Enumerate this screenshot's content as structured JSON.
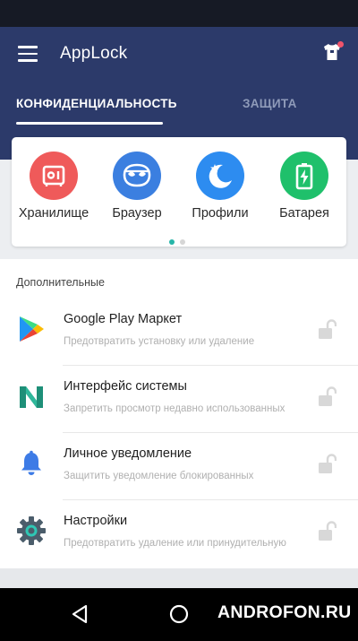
{
  "app": {
    "title": "AppLock"
  },
  "tabs": [
    {
      "label": "КОНФИДЕНЦИАЛЬНОСТЬ",
      "active": true
    },
    {
      "label": "ЗАЩИТА",
      "active": false
    }
  ],
  "quick_actions": [
    {
      "label": "Хранилище",
      "icon": "vault-icon",
      "color": "#ef5a5a"
    },
    {
      "label": "Браузер",
      "icon": "mask-icon",
      "color": "#3b7fe0"
    },
    {
      "label": "Профили",
      "icon": "moon-star-icon",
      "color": "#2d8cf0"
    },
    {
      "label": "Батарея",
      "icon": "battery-icon",
      "color": "#1fc06b"
    }
  ],
  "pager": {
    "pages": 2,
    "active": 1,
    "active_color": "#26b5a8",
    "inactive_color": "#d6d6d6"
  },
  "section": {
    "title": "Дополнительные"
  },
  "apps": [
    {
      "name": "Google Play Маркет",
      "description": "Предотвратить установку или удаление",
      "icon": "google-play-icon"
    },
    {
      "name": "Интерфейс системы",
      "description": "Запретить просмотр недавно использованных",
      "icon": "android-n-icon"
    },
    {
      "name": "Личное уведомление",
      "description": "Защитить уведомление блокированных",
      "icon": "bell-icon"
    },
    {
      "name": "Настройки",
      "description": "Предотвратить удаление или принудительную",
      "icon": "settings-gear-icon"
    }
  ],
  "watermark": "ANDROFON.RU",
  "colors": {
    "header": "#2c3a6a",
    "status_bar": "#161a25",
    "lock_icon": "#d8d8d8"
  }
}
